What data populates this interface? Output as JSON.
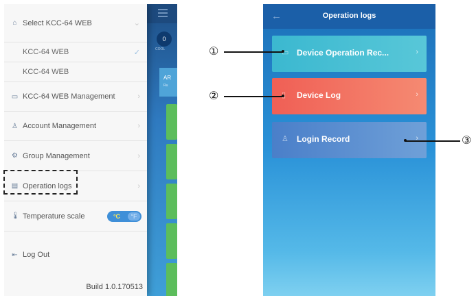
{
  "drawer": {
    "select_device": {
      "label": "Select KCC-64 WEB",
      "icon": "device-icon"
    },
    "devices": [
      {
        "label": "KCC-64 WEB",
        "selected": true
      },
      {
        "label": "KCC-64 WEB",
        "selected": false
      }
    ],
    "items": [
      {
        "label": "KCC-64 WEB Management",
        "icon": "monitor-icon"
      },
      {
        "label": "Account Management",
        "icon": "user-icon"
      },
      {
        "label": "Group Management",
        "icon": "gear-icon"
      },
      {
        "label": "Operation logs",
        "icon": "document-icon"
      }
    ],
    "temperature": {
      "label": "Temperature scale",
      "icon": "thermometer-icon",
      "active_unit": "°C",
      "inactive_unit": "°F"
    },
    "logout": {
      "label": "Log Out",
      "icon": "logout-icon"
    },
    "build": "Build 1.0.170513"
  },
  "app_background": {
    "badge_value": "0",
    "badge_sub": "COOL",
    "card_label": "AR",
    "card_sub": "Ru"
  },
  "operation_logs": {
    "title": "Operation logs",
    "items": [
      {
        "label": "Device Operation Rec...",
        "icon": "device-record-icon",
        "color": "#3bb8d0"
      },
      {
        "label": "Device Log",
        "icon": "clipboard-icon",
        "color": "#f05f55"
      },
      {
        "label": "Login Record",
        "icon": "user-group-icon",
        "color": "#4a7fc9"
      }
    ]
  },
  "callouts": [
    "①",
    "②",
    "③"
  ]
}
